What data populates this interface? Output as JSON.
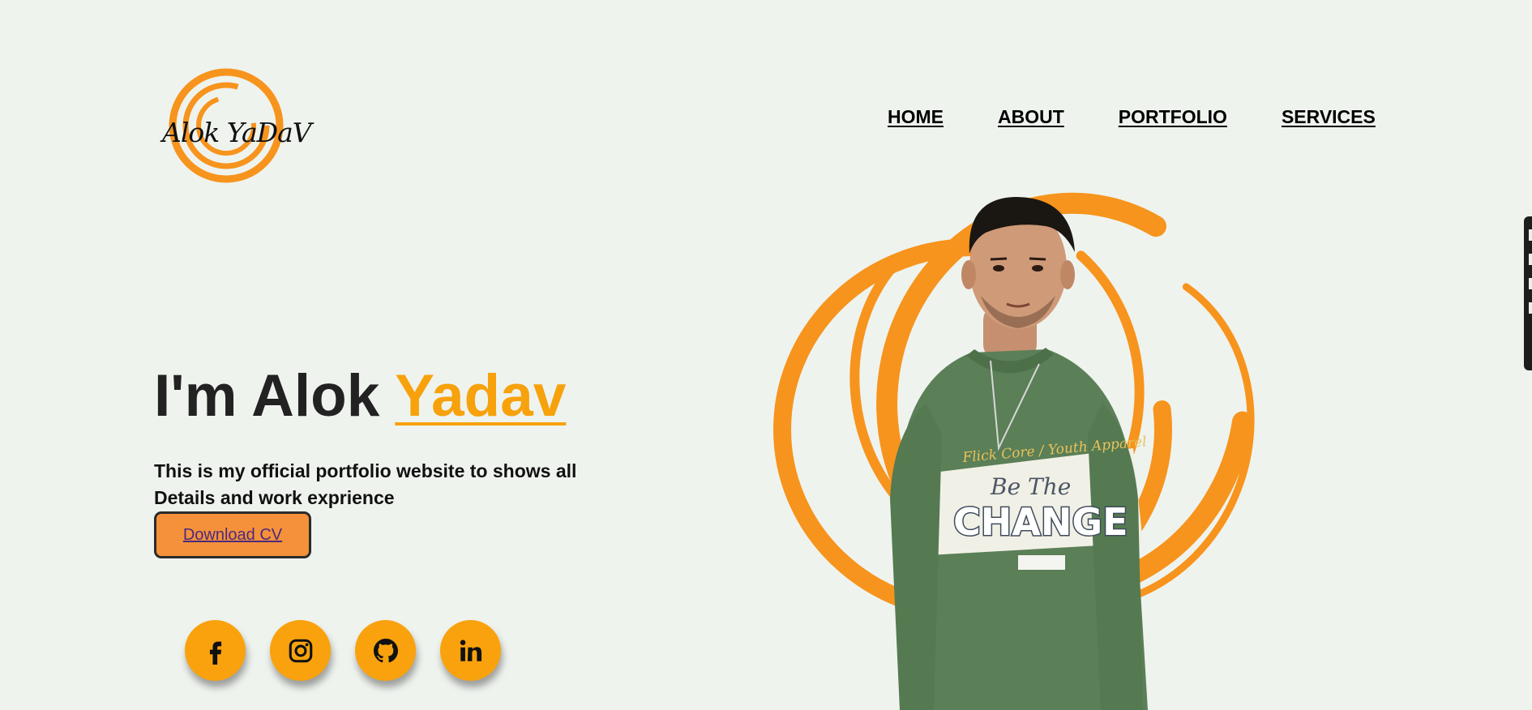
{
  "logo": {
    "text": "Alok YaDaV",
    "ring_color": "#f7941d"
  },
  "nav": {
    "items": [
      {
        "label": "HOME"
      },
      {
        "label": "ABOUT"
      },
      {
        "label": "PORTFOLIO"
      },
      {
        "label": "SERVICES"
      }
    ]
  },
  "hero": {
    "title_prefix": "I'm Alok ",
    "title_accent": "Yadav",
    "description_line1": "This is my official portfolio website to shows all",
    "description_line2": "Details and work exprience",
    "cta_label": "Download CV",
    "accent_color": "#f7a20c"
  },
  "socials": [
    {
      "icon": "facebook-icon"
    },
    {
      "icon": "instagram-icon"
    },
    {
      "icon": "github-icon"
    },
    {
      "icon": "linkedin-icon"
    }
  ],
  "hero_image": {
    "sweatshirt_line1": "Flick Core / Youth Apparel",
    "sweatshirt_line2": "Be The",
    "sweatshirt_line3": "CHANGE"
  }
}
